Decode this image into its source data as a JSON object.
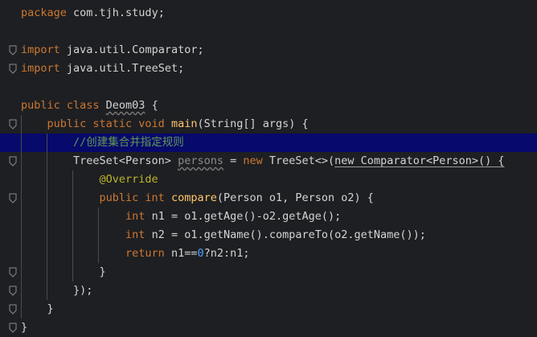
{
  "editor": {
    "lines": [
      {
        "n": 1,
        "parts": [
          {
            "t": "package ",
            "c": "kw"
          },
          {
            "t": "com.tjh.study;",
            "c": "pl"
          }
        ]
      },
      {
        "n": 2,
        "parts": []
      },
      {
        "n": 3,
        "parts": [
          {
            "t": "import ",
            "c": "kw"
          },
          {
            "t": "java.util.Comparator;",
            "c": "pl"
          }
        ]
      },
      {
        "n": 4,
        "parts": [
          {
            "t": "import ",
            "c": "kw"
          },
          {
            "t": "java.util.TreeSet;",
            "c": "pl"
          }
        ]
      },
      {
        "n": 5,
        "parts": []
      },
      {
        "n": 6,
        "parts": [
          {
            "t": "public class ",
            "c": "kw"
          },
          {
            "t": "Deom03",
            "c": "pl wavy"
          },
          {
            "t": " {",
            "c": "pl"
          }
        ]
      },
      {
        "n": 7,
        "parts": [
          {
            "t": "    public static void ",
            "c": "kw"
          },
          {
            "t": "main",
            "c": "fn"
          },
          {
            "t": "(String[] args) {",
            "c": "pl"
          }
        ]
      },
      {
        "n": 8,
        "parts": [
          {
            "t": "        //创建集合并指定规则",
            "c": "cm"
          }
        ]
      },
      {
        "n": 9,
        "parts": [
          {
            "t": "        TreeSet<Person> ",
            "c": "pl"
          },
          {
            "t": "persons",
            "c": "unused wavy"
          },
          {
            "t": " = ",
            "c": "pl"
          },
          {
            "t": "new ",
            "c": "kw"
          },
          {
            "t": "TreeSet<>(",
            "c": "pl"
          },
          {
            "t": "new Comparator<Person>() {",
            "c": "under pl"
          }
        ]
      },
      {
        "n": 10,
        "parts": [
          {
            "t": "            @Override",
            "c": "an"
          }
        ]
      },
      {
        "n": 11,
        "parts": [
          {
            "t": "            public int ",
            "c": "kw"
          },
          {
            "t": "compare",
            "c": "fn"
          },
          {
            "t": "(Person o1, Person o2) {",
            "c": "pl"
          }
        ]
      },
      {
        "n": 12,
        "parts": [
          {
            "t": "                int ",
            "c": "kw"
          },
          {
            "t": "n1 = o1.getAge()-o2.getAge();",
            "c": "pl"
          }
        ]
      },
      {
        "n": 13,
        "parts": [
          {
            "t": "                int ",
            "c": "kw"
          },
          {
            "t": "n2 = o1.getName().compareTo(o2.getName());",
            "c": "pl"
          }
        ]
      },
      {
        "n": 14,
        "parts": [
          {
            "t": "                return ",
            "c": "kw"
          },
          {
            "t": "n1==",
            "c": "pl"
          },
          {
            "t": "0",
            "c": "num"
          },
          {
            "t": "?n2:n1;",
            "c": "pl"
          }
        ]
      },
      {
        "n": 15,
        "parts": [
          {
            "t": "            }",
            "c": "pl"
          }
        ]
      },
      {
        "n": 16,
        "parts": [
          {
            "t": "        });",
            "c": "pl"
          }
        ]
      },
      {
        "n": 17,
        "parts": [
          {
            "t": "    }",
            "c": "pl"
          }
        ]
      },
      {
        "n": 18,
        "parts": [
          {
            "t": "}",
            "c": "pl"
          }
        ]
      }
    ],
    "current_line": 8,
    "fold_markers": [
      3,
      4,
      7,
      9,
      11,
      15,
      16,
      17,
      18
    ],
    "colors": {
      "background": "#1e1f22",
      "current_line": "#07096b",
      "keyword": "#cc7832",
      "function": "#ffc66d",
      "comment": "#629755",
      "annotation": "#bbb529",
      "number": "#4aa3ff"
    }
  }
}
